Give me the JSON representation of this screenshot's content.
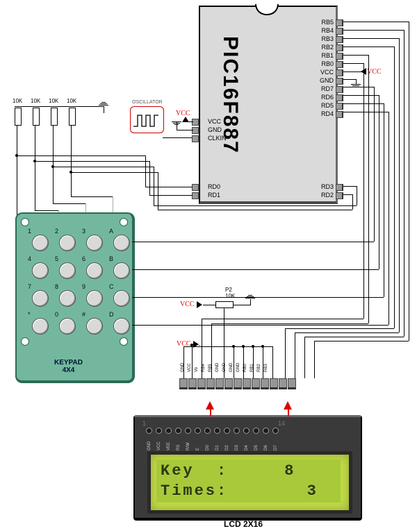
{
  "chip": {
    "name": "PIC16F887",
    "left_pins": [
      "VCC",
      "GND",
      "CLKIN",
      "RD0",
      "RD1"
    ],
    "right_pins": [
      "RB5",
      "RB4",
      "RB3",
      "RB2",
      "RB1",
      "RB0",
      "VCC",
      "GND",
      "RD7",
      "RD6",
      "RD5",
      "RD4",
      "RD3",
      "RD2"
    ]
  },
  "oscillator": {
    "label": "OSCILLATOR"
  },
  "power": {
    "vcc_label": "VCC",
    "pot_label": "P2",
    "pot_value": "10K"
  },
  "resistors": {
    "value": "10K",
    "count": 4
  },
  "keypad": {
    "title": "KEYPAD\n4X4",
    "rows": [
      [
        "1",
        "2",
        "3",
        "A"
      ],
      [
        "4",
        "5",
        "6",
        "B"
      ],
      [
        "7",
        "8",
        "9",
        "C"
      ],
      [
        "*",
        "0",
        "#",
        "D"
      ]
    ]
  },
  "connector": {
    "labels": [
      "GND",
      "VCC",
      "Vo",
      "RB4",
      "RB5",
      "GND",
      "GND",
      "GND",
      "GND",
      "RB0",
      "RB1",
      "RB2",
      "RB3"
    ]
  },
  "lcd": {
    "title": "LCD 2X16",
    "pin_first": "1",
    "pin_last": "14",
    "pins": [
      "GND",
      "VCC",
      "VEE",
      "RS",
      "R/W",
      "E",
      "D0",
      "D1",
      "D2",
      "D3",
      "D4",
      "D5",
      "D6",
      "D7"
    ],
    "line1": "Key  :     8",
    "line2": "Times:       3"
  }
}
